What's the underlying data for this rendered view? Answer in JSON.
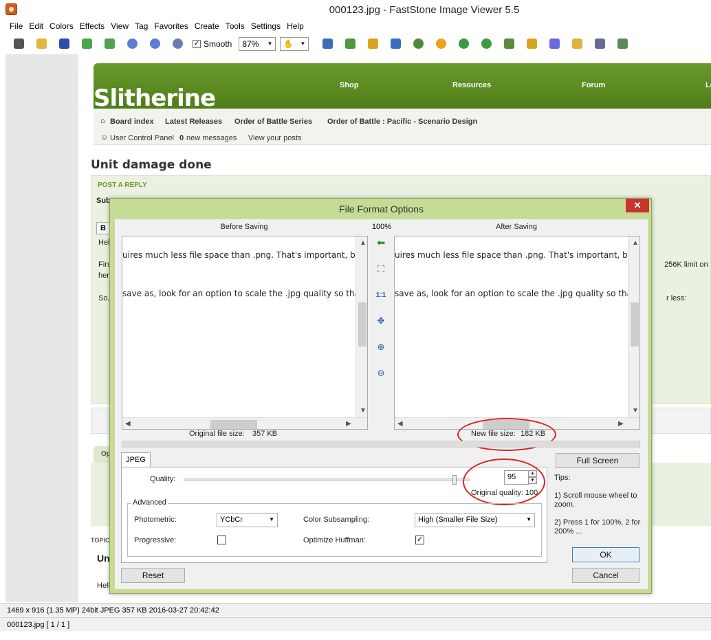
{
  "window": {
    "title": "000123.jpg  -  FastStone Image Viewer 5.5"
  },
  "menu": [
    "File",
    "Edit",
    "Colors",
    "Effects",
    "View",
    "Tag",
    "Favorites",
    "Create",
    "Tools",
    "Settings",
    "Help"
  ],
  "toolbar": {
    "smooth_label": "Smooth",
    "zoom_value": "87%"
  },
  "webpage": {
    "logo": "Slitherine",
    "nav": [
      "Shop",
      "Resources",
      "Forum",
      "Lo"
    ],
    "breadcrumbs": [
      "Board index",
      "Latest Releases",
      "Order of Battle Series",
      "Order of Battle : Pacific - Scenario Design"
    ],
    "ucp": {
      "panel": "User Control Panel",
      "count": "0",
      "messages": "new messages",
      "view": "View your posts"
    },
    "heading": "Unit damage done",
    "post_reply": "POST A REPLY",
    "subj": "Sub",
    "b_btn": "B",
    "hel": "Hel",
    "firs": "Firs",
    "her": "her",
    "so": "So,",
    "limit": "256K limit on",
    "less": "r less:",
    "op": "Op",
    "topic": "TOPIC",
    "unt": "Unt",
    "hell": "Hell"
  },
  "status": {
    "line1": "1469 x 916 (1.35 MP)  24bit  JPEG   357 KB   2016-03-27 20:42:42",
    "line2": "000123.jpg [ 1 / 1 ]"
  },
  "dialog": {
    "title": "File Format Options",
    "close": "✕",
    "before_label": "Before Saving",
    "after_label": "After Saving",
    "zoom": "100%",
    "one_to_one": "1:1",
    "preview_line1": "uires much less file space than .png.  That's important, be",
    "preview_line2": "save as, look for an option to scale the .jpg quality so tha",
    "original_size_label": "Original file size:",
    "original_size_value": "357 KB",
    "new_size_label": "New file size:",
    "new_size_value": "182 KB",
    "tab": "JPEG",
    "full_screen": "Full Screen",
    "quality_label": "Quality:",
    "quality_value": "95",
    "quality_slider_percent": 95,
    "original_quality": "Original quality: 100",
    "advanced": "Advanced",
    "photometric_label": "Photometric:",
    "photometric_value": "YCbCr",
    "subsampling_label": "Color Subsampling:",
    "subsampling_value": "High (Smaller File Size)",
    "progressive_label": "Progressive:",
    "huffman_label": "Optimize Huffman:",
    "tips_title": "Tips:",
    "tip1": "1) Scroll mouse wheel to zoom.",
    "tip2": "2) Press 1 for 100%, 2 for 200% ...",
    "ok": "OK",
    "cancel": "Cancel",
    "reset": "Reset"
  }
}
